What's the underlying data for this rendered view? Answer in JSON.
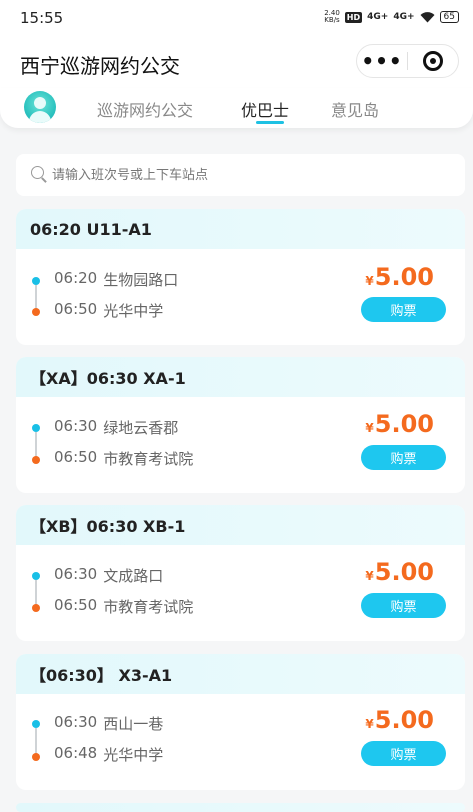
{
  "status_bar": {
    "time": "15:55",
    "speed": "2.40",
    "speed_unit": "KB/s",
    "hd": "HD",
    "signal1": "4G+",
    "signal2": "4G+",
    "battery": "65"
  },
  "app": {
    "title": "西宁巡游网约公交",
    "more_icon": "ellipsis-icon",
    "close_icon": "target-close-icon"
  },
  "tabs": [
    {
      "label": "巡游网约公交",
      "active": false
    },
    {
      "label": "优巴士",
      "active": true
    },
    {
      "label": "意见岛",
      "active": false
    }
  ],
  "search": {
    "placeholder": "请输入班次号或上下车站点"
  },
  "colors": {
    "accent": "#1ec7ef",
    "price": "#f46a1e",
    "start_dot": "#19bfe6",
    "end_dot": "#f46a1e"
  },
  "routes": [
    {
      "title": "06:20 U11-A1",
      "start_time": "06:20",
      "start_stop": "生物园路口",
      "end_time": "06:50",
      "end_stop": "光华中学",
      "currency": "¥",
      "price": "5.00",
      "button": "购票"
    },
    {
      "title": "【XA】06:30 XA-1",
      "start_time": "06:30",
      "start_stop": "绿地云香郡",
      "end_time": "06:50",
      "end_stop": "市教育考试院",
      "currency": "¥",
      "price": "5.00",
      "button": "购票"
    },
    {
      "title": "【XB】06:30 XB-1",
      "start_time": "06:30",
      "start_stop": "文成路口",
      "end_time": "06:50",
      "end_stop": "市教育考试院",
      "currency": "¥",
      "price": "5.00",
      "button": "购票"
    },
    {
      "title": "【06:30】 X3-A1",
      "start_time": "06:30",
      "start_stop": "西山一巷",
      "end_time": "06:48",
      "end_stop": "光华中学",
      "currency": "¥",
      "price": "5.00",
      "button": "购票"
    }
  ]
}
